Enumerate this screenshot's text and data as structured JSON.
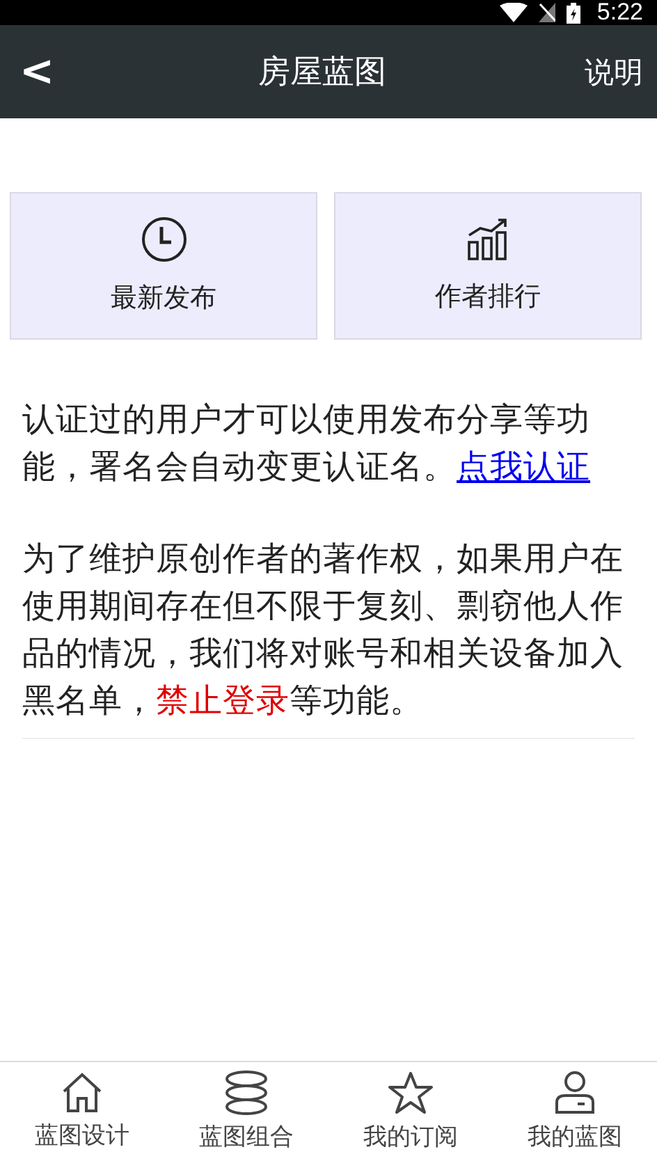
{
  "status_bar": {
    "time": "5:22"
  },
  "app_bar": {
    "back": "<",
    "title": "房屋蓝图",
    "action": "说明"
  },
  "cards": [
    {
      "kind": "clock",
      "label": "最新发布"
    },
    {
      "kind": "chart",
      "label": "作者排行"
    }
  ],
  "paragraphs": [
    {
      "text": "认证过的用户才可以使用发布分享等功能，署名会自动变更认证名。",
      "link": "点我认证"
    },
    {
      "before": "为了维护原创作者的著作权，如果用户在使用期间存在但不限于复刻、剽窃他人作品的情况，我们将对账号和相关设备加入黑名单，",
      "warning": "禁止登录",
      "after": "等功能。"
    }
  ],
  "tabs": [
    {
      "kind": "home",
      "label": "蓝图设计"
    },
    {
      "kind": "stack",
      "label": "蓝图组合"
    },
    {
      "kind": "star",
      "label": "我的订阅"
    },
    {
      "kind": "user",
      "label": "我的蓝图"
    }
  ]
}
